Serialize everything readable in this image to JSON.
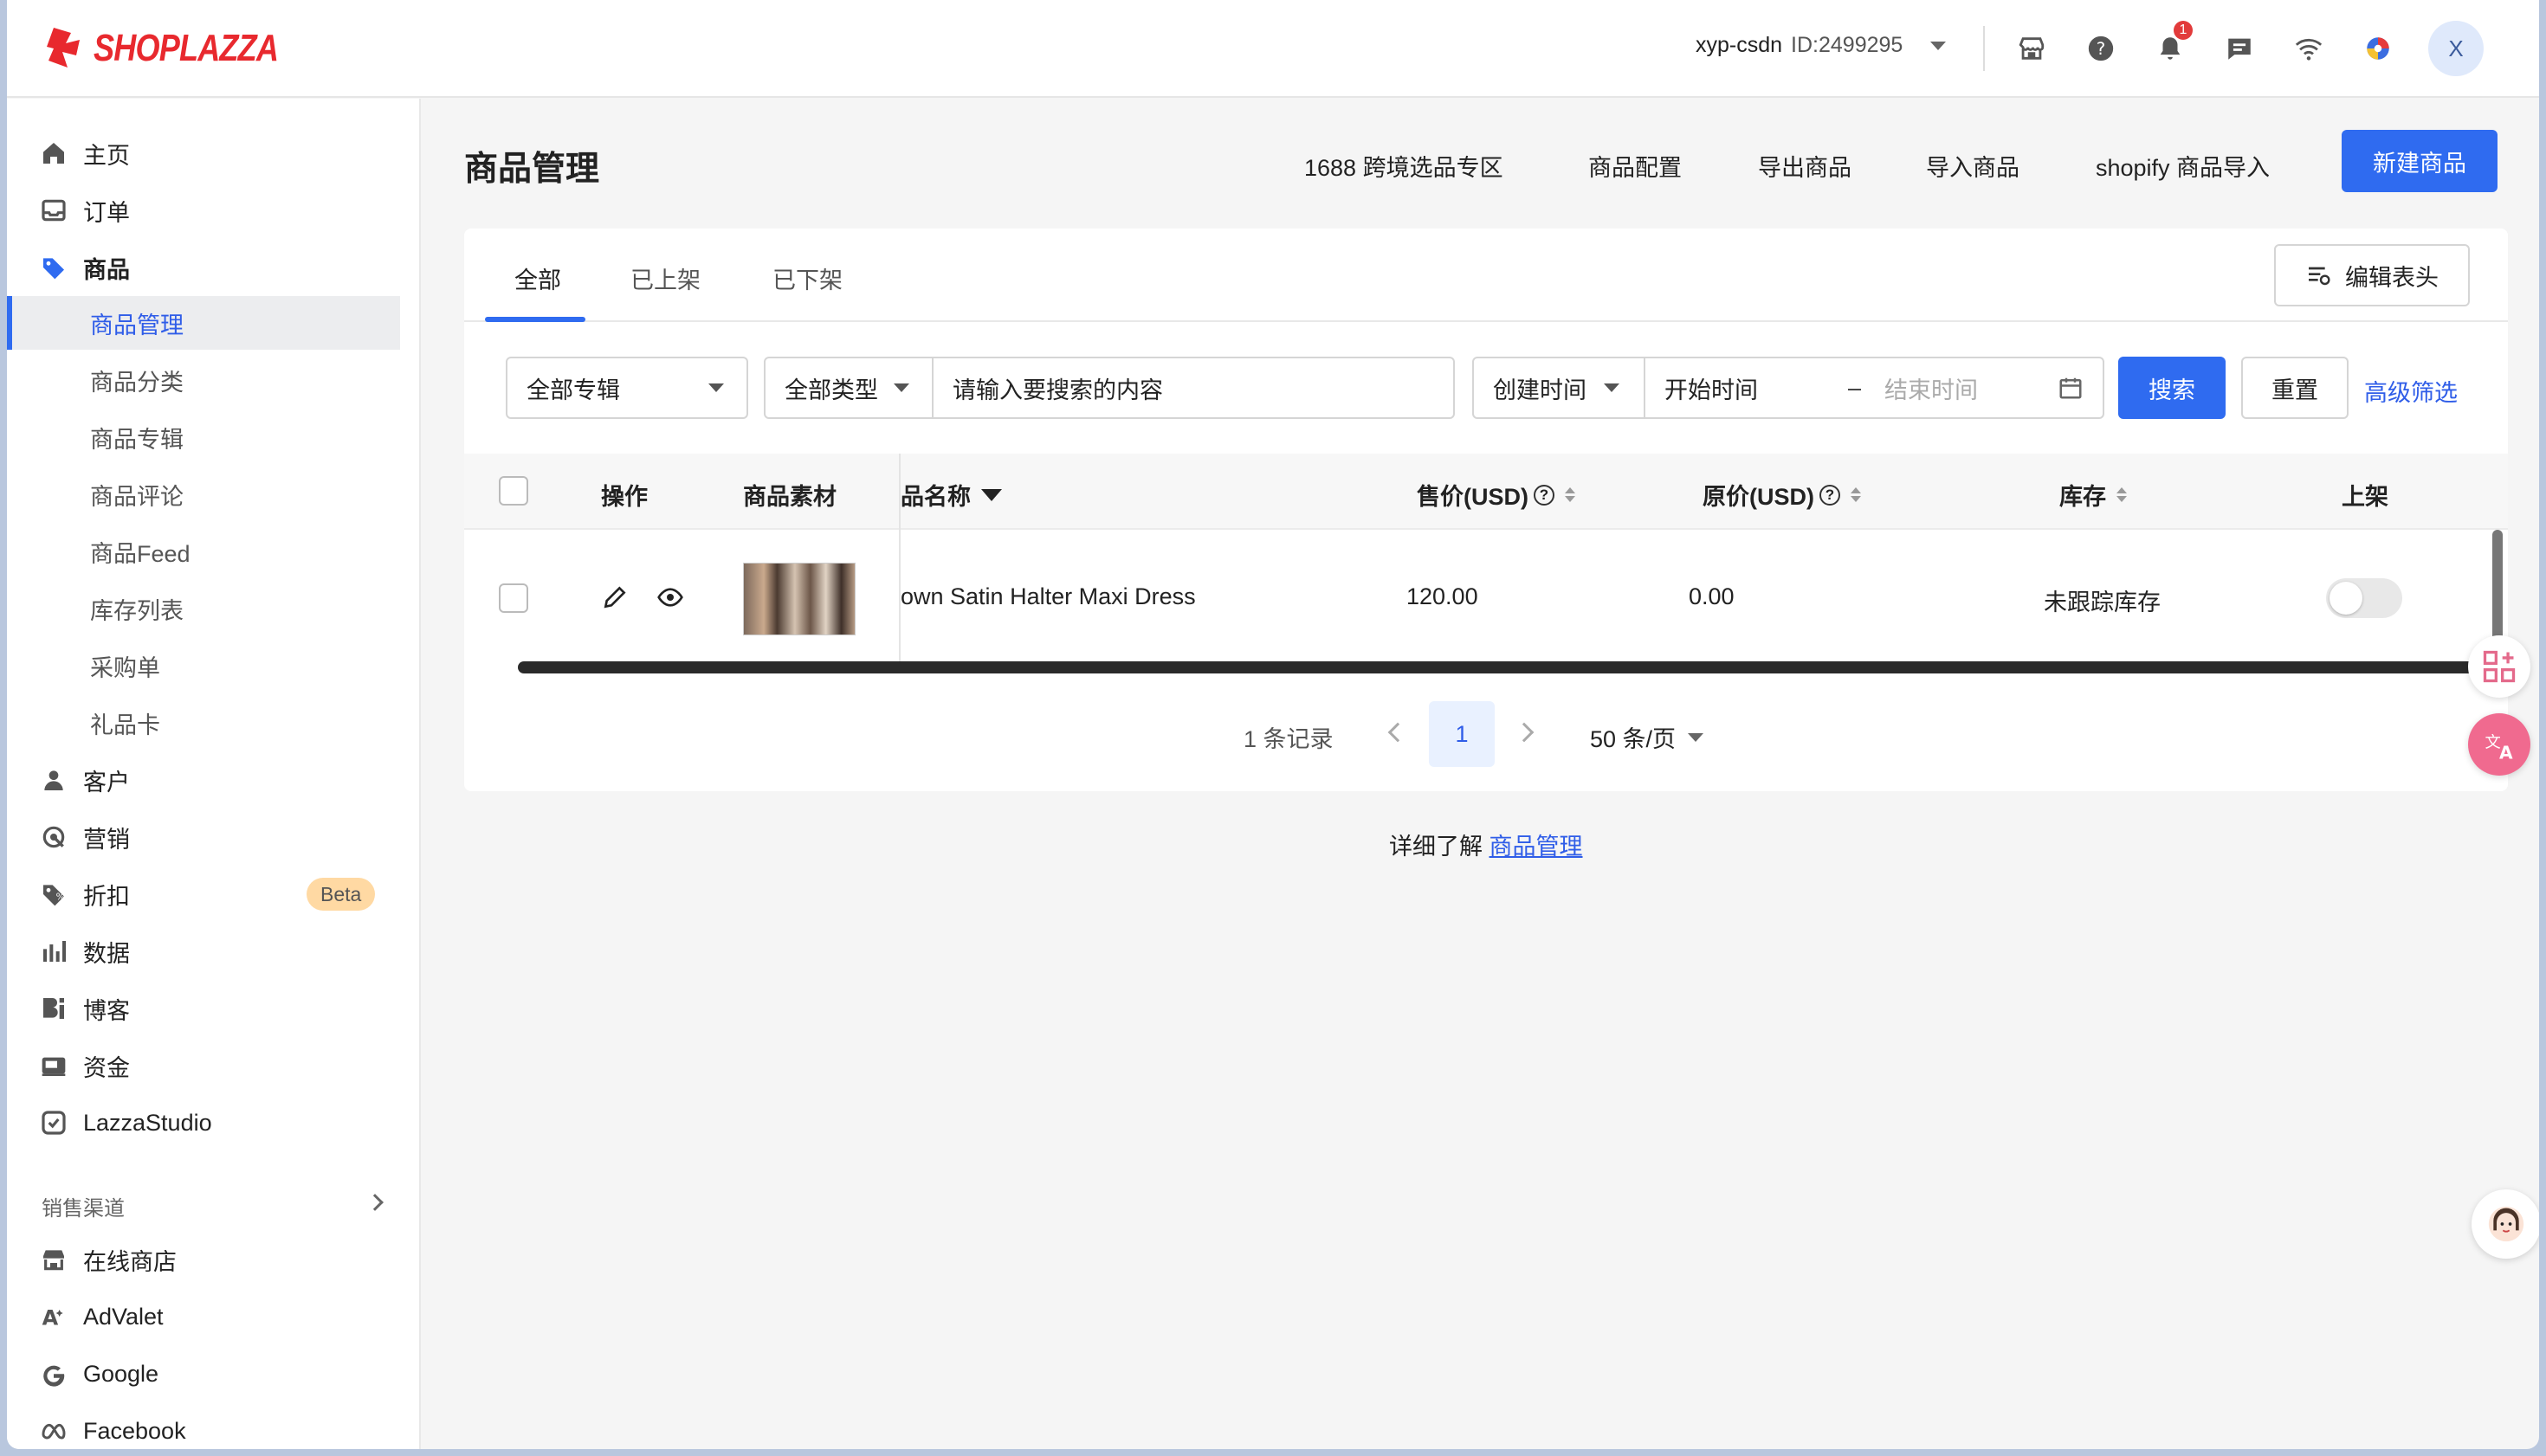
{
  "header": {
    "logo_text": "SHOPLAZZA",
    "store_name": "xyp-csdn",
    "store_id": "ID:2499295",
    "notification_count": "1",
    "avatar_initial": "X",
    "icons": [
      "store-icon",
      "help-icon",
      "bell-icon",
      "message-icon",
      "wifi-icon",
      "color-wheel-icon"
    ]
  },
  "sidebar": {
    "items": [
      {
        "label": "主页",
        "icon": "home-icon"
      },
      {
        "label": "订单",
        "icon": "inbox-icon"
      },
      {
        "label": "商品",
        "icon": "tag-icon"
      }
    ],
    "product_sub": [
      {
        "label": "商品管理"
      },
      {
        "label": "商品分类"
      },
      {
        "label": "商品专辑"
      },
      {
        "label": "商品评论"
      },
      {
        "label": "商品Feed"
      },
      {
        "label": "库存列表"
      },
      {
        "label": "采购单"
      },
      {
        "label": "礼品卡"
      }
    ],
    "items2": [
      {
        "label": "客户",
        "icon": "user-icon"
      },
      {
        "label": "营销",
        "icon": "marketing-icon"
      },
      {
        "label": "折扣",
        "icon": "discount-icon",
        "badge": "Beta"
      },
      {
        "label": "数据",
        "icon": "chart-icon"
      },
      {
        "label": "博客",
        "icon": "blog-icon"
      },
      {
        "label": "资金",
        "icon": "wallet-icon"
      },
      {
        "label": "LazzaStudio",
        "icon": "studio-icon"
      }
    ],
    "sales_channel_title": "销售渠道",
    "channels": [
      {
        "label": "在线商店",
        "icon": "store-icon"
      },
      {
        "label": "AdValet",
        "icon": "advalet-icon"
      },
      {
        "label": "Google",
        "icon": "google-icon"
      },
      {
        "label": "Facebook",
        "icon": "meta-icon"
      }
    ]
  },
  "main": {
    "title": "商品管理",
    "header_links": [
      "1688 跨境选品专区",
      "商品配置",
      "导出商品",
      "导入商品",
      "shopify 商品导入"
    ],
    "new_button": "新建商品",
    "tabs": [
      "全部",
      "已上架",
      "已下架"
    ],
    "edit_header_button": "编辑表头",
    "filters": {
      "collection": "全部专辑",
      "type": "全部类型",
      "search_placeholder": "请输入要搜索的内容",
      "time_type": "创建时间",
      "start_placeholder": "开始时间",
      "range_sep": "–",
      "end_placeholder": "结束时间",
      "search_button": "搜索",
      "reset_button": "重置",
      "advanced_link": "高级筛选"
    },
    "table": {
      "columns": [
        "操作",
        "商品素材",
        "商品名称",
        "售价(USD)",
        "原价(USD)",
        "库存",
        "上架"
      ],
      "columns_display": [
        "操作",
        "商品素材",
        "品名称",
        "售价(USD)",
        "原价(USD)",
        "库存",
        "上架"
      ],
      "rows": [
        {
          "name": "own Satin Halter Maxi Dress",
          "price": "120.00",
          "original_price": "0.00",
          "stock": "未跟踪库存",
          "published": false
        }
      ]
    },
    "pagination": {
      "total": "1 条记录",
      "current_page": "1",
      "page_size": "50 条/页"
    },
    "footer": {
      "prefix": "详细了解",
      "link": "商品管理"
    }
  }
}
